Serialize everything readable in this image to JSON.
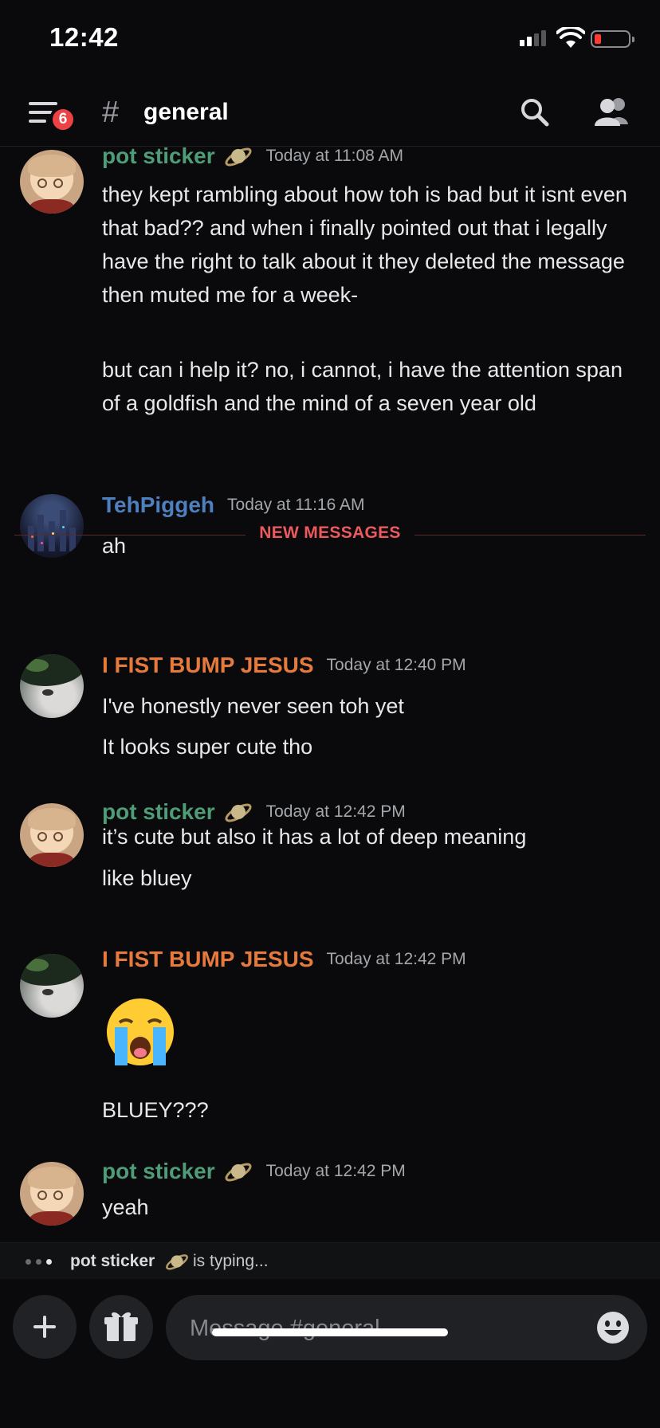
{
  "status_bar": {
    "time": "12:42"
  },
  "header": {
    "notification_count": "6",
    "channel_hash": "#",
    "channel_name": "general"
  },
  "messages": [
    {
      "author": "pot sticker",
      "timestamp": "Today at 11:08 AM",
      "lines": [
        "they kept rambling about how toh is bad but it isnt even that bad?? and when i finally pointed out that i legally have the right to talk about it they deleted the message then muted me for a week-",
        "but can i help it? no, i cannot, i have the attention span of a goldfish and the mind of a seven year old"
      ]
    },
    {
      "author": "TehPiggeh",
      "timestamp": "Today at 11:16 AM",
      "lines": [
        "ah"
      ]
    },
    {
      "author": "I FIST BUMP JESUS",
      "timestamp": "Today at 12:40 PM",
      "lines": [
        "I've honestly never seen toh yet",
        "It looks super cute tho"
      ]
    },
    {
      "author": "pot sticker",
      "timestamp": "Today at 12:42 PM",
      "lines": [
        "it’s cute but also it has a lot of deep meaning",
        "like bluey"
      ]
    },
    {
      "author": "I FIST BUMP JESUS",
      "timestamp": "Today at 12:42 PM",
      "emoji": "loudly-crying-face",
      "lines": [
        "BLUEY???"
      ]
    },
    {
      "author": "pot sticker",
      "timestamp": "Today at 12:42 PM",
      "lines": [
        "yeah"
      ]
    }
  ],
  "divider": {
    "label": "NEW MESSAGES"
  },
  "typing": {
    "user": "pot sticker",
    "text": "is typing..."
  },
  "composer": {
    "placeholder": "Message #general"
  },
  "colors": {
    "background": "#0a0a0c",
    "pot_sticker_name": "#4f9d78",
    "tehpiggeh_name": "#4e7fbf",
    "fist_bump_name": "#e67a3c",
    "new_messages": "#ed5a5e",
    "badge": "#ed4245"
  }
}
